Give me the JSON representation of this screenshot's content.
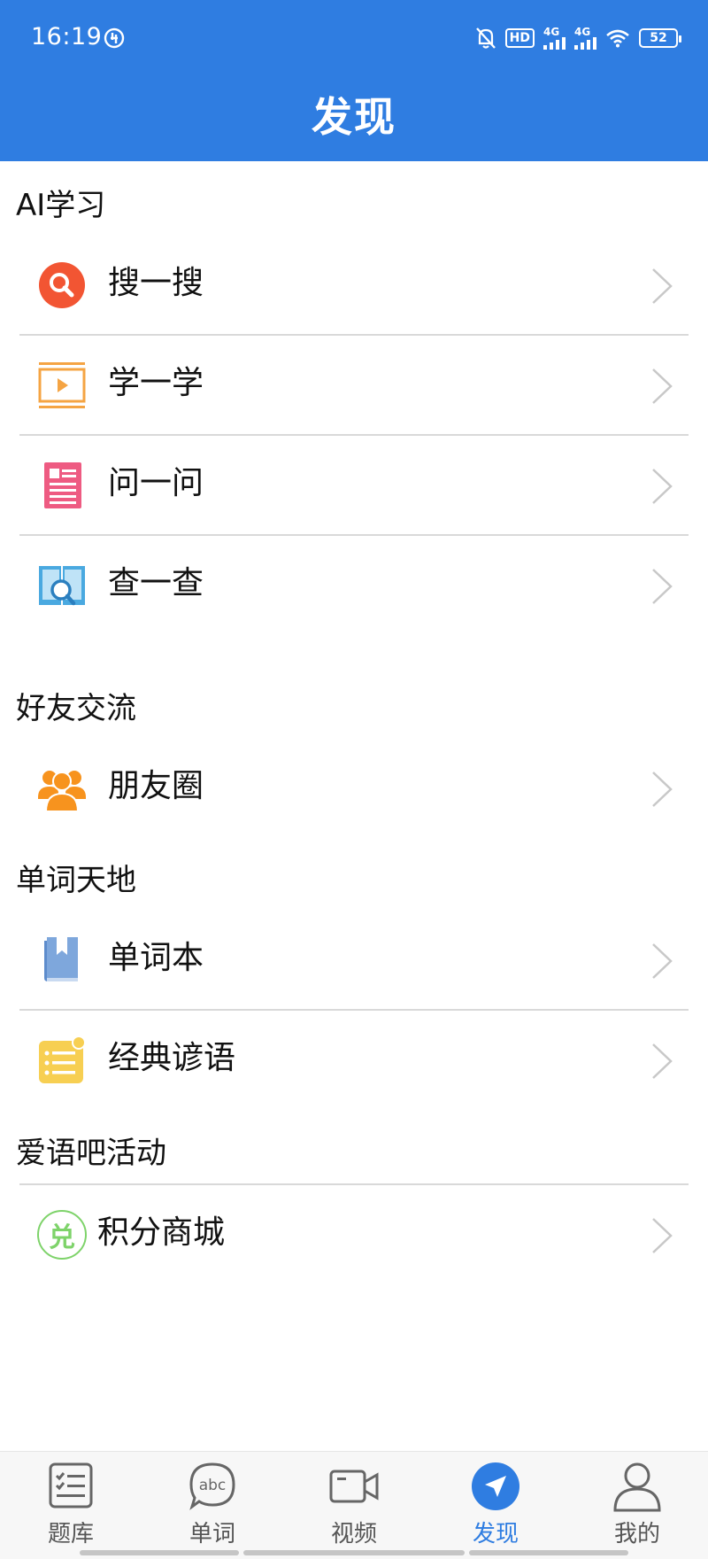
{
  "status_bar": {
    "time": "16:19",
    "hd_badge": "HD",
    "signal_1": "4G",
    "signal_2": "4G",
    "battery": "52"
  },
  "header": {
    "title": "发现"
  },
  "sections": {
    "ai": {
      "title": "AI学习",
      "items": [
        {
          "label": "搜一搜",
          "icon": "search-icon",
          "color": "#f25533"
        },
        {
          "label": "学一学",
          "icon": "video-play-icon",
          "color": "#f5a443"
        },
        {
          "label": "问一问",
          "icon": "document-icon",
          "color": "#ee5b82"
        },
        {
          "label": "查一查",
          "icon": "book-search-icon",
          "color": "#4aa9e0"
        }
      ]
    },
    "friends": {
      "title": "好友交流",
      "items": [
        {
          "label": "朋友圈",
          "icon": "group-icon",
          "color": "#f7931e"
        }
      ]
    },
    "words": {
      "title": "单词天地",
      "items": [
        {
          "label": "单词本",
          "icon": "wordbook-icon",
          "color": "#7ea7dc"
        },
        {
          "label": "经典谚语",
          "icon": "proverb-list-icon",
          "color": "#f7cf52"
        }
      ]
    },
    "activity": {
      "title": "爱语吧活动",
      "items": [
        {
          "label": "积分商城",
          "icon": "exchange-icon",
          "icon_text": "兑",
          "color": "#7ed36a"
        }
      ]
    }
  },
  "bottom_nav": {
    "items": [
      {
        "label": "题库",
        "icon": "question-bank-icon"
      },
      {
        "label": "单词",
        "icon": "abc-bubble-icon",
        "icon_text": "abc"
      },
      {
        "label": "视频",
        "icon": "video-camera-icon"
      },
      {
        "label": "发现",
        "icon": "discover-icon",
        "active": true
      },
      {
        "label": "我的",
        "icon": "profile-icon"
      }
    ]
  },
  "colors": {
    "primary": "#2f7de1",
    "divider": "#d9d9d9",
    "chevron": "#c8c8c8"
  }
}
